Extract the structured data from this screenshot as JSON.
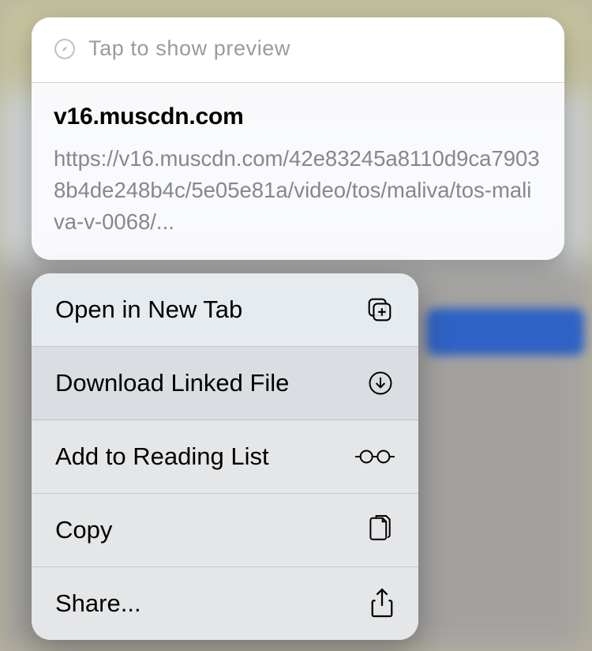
{
  "preview": {
    "header_label": "Tap to show preview",
    "title": "v16.muscdn.com",
    "url": "https://v16.muscdn.com/42e83245a8110d9ca79038b4de248b4c/5e05e81a/video/tos/maliva/tos-maliva-v-0068/..."
  },
  "menu": {
    "open_new_tab": "Open in New Tab",
    "download": "Download Linked File",
    "reading_list": "Add to Reading List",
    "copy": "Copy",
    "share": "Share..."
  }
}
